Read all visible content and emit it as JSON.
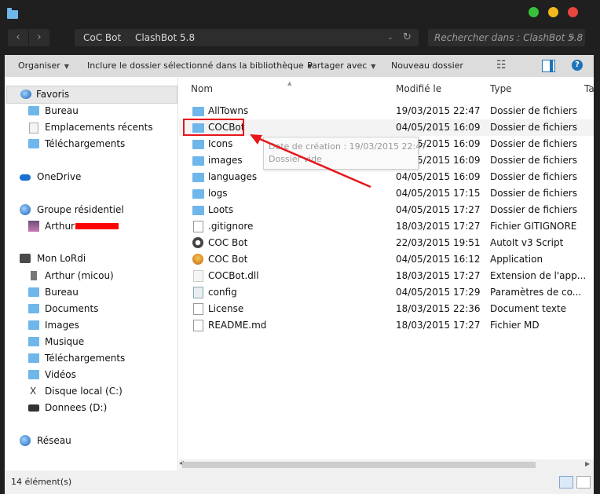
{
  "window": {
    "controls": [
      "maximize-green",
      "minimize-yellow",
      "close-red"
    ]
  },
  "nav": {
    "back_label": "‹",
    "forward_label": "›",
    "address_crumbs": [
      "CoC Bot",
      "ClashBot 5.8"
    ],
    "address_dropdown": "⌄",
    "refresh": "↻",
    "search_placeholder": "Rechercher dans : ClashBot 5.8",
    "search_icon": "⌕"
  },
  "toolbar": {
    "organize": "Organiser",
    "include": "Inclure le dossier sélectionné dans la bibliothèque",
    "share": "Partager avec",
    "new_folder": "Nouveau dossier",
    "views_icon": "☷",
    "help": "?"
  },
  "sidebar": {
    "favorites": {
      "header": "Favoris",
      "items": [
        "Bureau",
        "Emplacements récents",
        "Téléchargements"
      ]
    },
    "onedrive": "OneDrive",
    "homegroup": {
      "header": "Groupe résidentiel",
      "user": "Arthur"
    },
    "computer": {
      "header": "Mon LoRdi",
      "items": [
        "Arthur (micou)",
        "Bureau",
        "Documents",
        "Images",
        "Musique",
        "Téléchargements",
        "Vidéos",
        "Disque local (C:)",
        "Donnees (D:)"
      ]
    },
    "network": "Réseau"
  },
  "columns": {
    "name": "Nom",
    "modified": "Modifié le",
    "type": "Type",
    "size": "Ta"
  },
  "files": [
    {
      "name": "AllTowns",
      "modified": "19/03/2015 22:47",
      "type": "Dossier de fichiers",
      "icon": "folder"
    },
    {
      "name": "COCBot",
      "modified": "04/05/2015 16:09",
      "type": "Dossier de fichiers",
      "icon": "folder"
    },
    {
      "name": "Icons",
      "modified": "04/05/2015 16:09",
      "type": "Dossier de fichiers",
      "icon": "folder"
    },
    {
      "name": "images",
      "modified": "04/05/2015 16:09",
      "type": "Dossier de fichiers",
      "icon": "folder"
    },
    {
      "name": "languages",
      "modified": "04/05/2015 16:09",
      "type": "Dossier de fichiers",
      "icon": "folder"
    },
    {
      "name": "logs",
      "modified": "04/05/2015 17:15",
      "type": "Dossier de fichiers",
      "icon": "folder"
    },
    {
      "name": "Loots",
      "modified": "04/05/2015 17:27",
      "type": "Dossier de fichiers",
      "icon": "folder"
    },
    {
      "name": ".gitignore",
      "modified": "18/03/2015 17:27",
      "type": "Fichier GITIGNORE",
      "icon": "doc"
    },
    {
      "name": "COC Bot",
      "modified": "22/03/2015 19:51",
      "type": "AutoIt v3 Script",
      "icon": "autoit"
    },
    {
      "name": "COC Bot",
      "modified": "04/05/2015 16:12",
      "type": "Application",
      "icon": "app"
    },
    {
      "name": "COCBot.dll",
      "modified": "18/03/2015 17:27",
      "type": "Extension de l'app...",
      "icon": "dll"
    },
    {
      "name": "config",
      "modified": "04/05/2015 17:29",
      "type": "Paramètres de co...",
      "icon": "config"
    },
    {
      "name": "License",
      "modified": "18/03/2015 22:36",
      "type": "Document texte",
      "icon": "doc"
    },
    {
      "name": "README.md",
      "modified": "18/03/2015 17:27",
      "type": "Fichier MD",
      "icon": "doc"
    }
  ],
  "tooltip": {
    "line1": "Date de création : 19/03/2015 22:47",
    "line2": "Dossier vide"
  },
  "status": {
    "count": "14 élément(s)"
  }
}
